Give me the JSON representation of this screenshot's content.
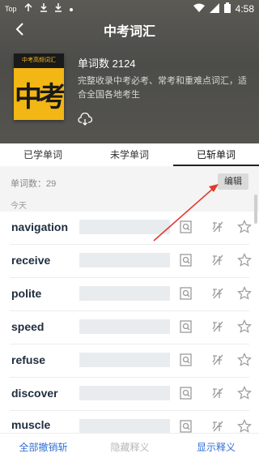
{
  "statusbar": {
    "app_label": "Top",
    "time": "4:58"
  },
  "header": {
    "title": "中考词汇"
  },
  "book": {
    "cover_title": "中考高频词汇",
    "cover_big": "中考",
    "word_count": "单词数 2124",
    "description": "完整收录中考必考、常考和重难点词汇，适合全国各地考生"
  },
  "tabs": [
    {
      "label": "已学单词"
    },
    {
      "label": "未学单词"
    },
    {
      "label": "已斩单词"
    }
  ],
  "summary": {
    "count_label": "单词数：29",
    "edit_label": "编辑",
    "section_label": "今天"
  },
  "words": [
    {
      "word": "navigation"
    },
    {
      "word": "receive"
    },
    {
      "word": "polite"
    },
    {
      "word": "speed"
    },
    {
      "word": "refuse"
    },
    {
      "word": "discover"
    },
    {
      "word": "muscle"
    }
  ],
  "bottom_bar": {
    "undo_all": "全部撤销斩",
    "hide_meaning": "隐藏释义",
    "show_meaning": "显示释义"
  },
  "colors": {
    "accent": "#2f6fd6",
    "arrow": "#e23a2e",
    "disabled": "#b8b8b8"
  }
}
